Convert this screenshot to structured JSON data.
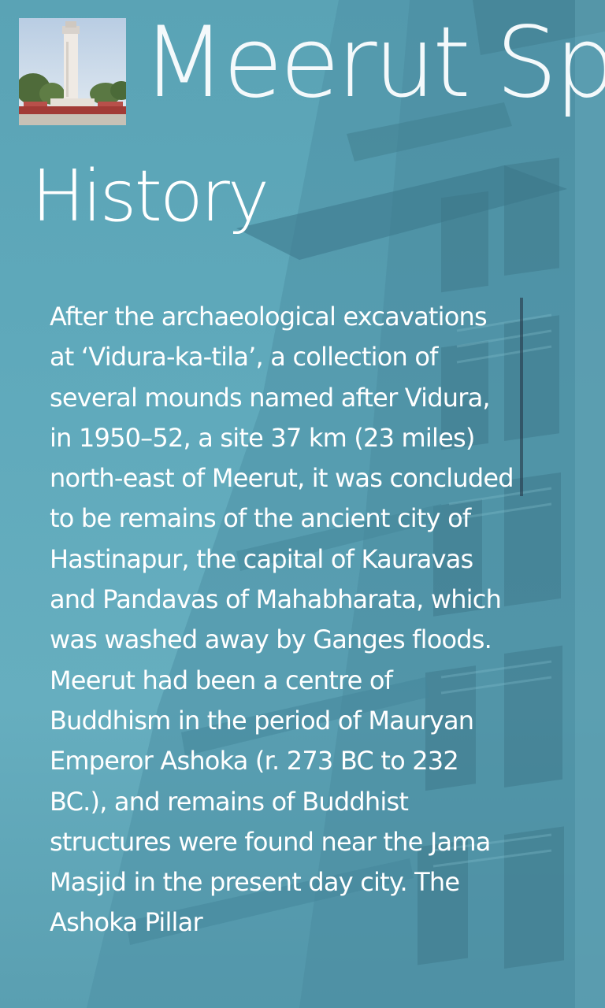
{
  "app": {
    "title": "Meerut Sp",
    "logo_icon": "clock-tower-image"
  },
  "page": {
    "title": "History"
  },
  "content": {
    "paragraphs": [
      "After the archaeological excavations at ‘Vidura-ka-tila’, a collection of several mounds named after Vidura, in 1950–52, a site 37 km (23 miles) north-east of Meerut, it was concluded to be remains of the ancient city of Hastinapur, the capital of Kauravas and Pandavas of Mahabharata, which was washed away by Ganges floods.",
      "Meerut had been a centre of Buddhism in the period of Mauryan Emperor Ashoka (r. 273 BC to 232 BC.), and remains of Buddhist structures were found near the Jama Masjid in the present day city. The Ashoka Pillar"
    ]
  },
  "colors": {
    "background": "#5fa3b6",
    "text": "#ffffff"
  }
}
